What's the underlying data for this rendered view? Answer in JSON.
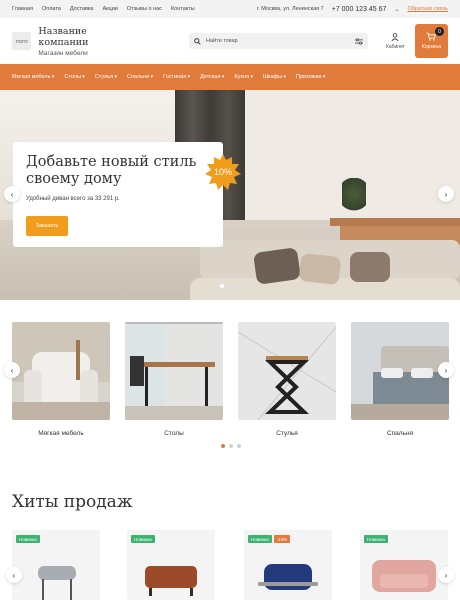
{
  "topbar": {
    "nav": [
      "Главная",
      "Оплата",
      "Доставка",
      "Акции",
      "Отзывы о нас",
      "Контакты"
    ],
    "address": "г. Москва, ул. Ленинская 7",
    "phone": "+7 000 123 45 67",
    "callback": "Обратная связь"
  },
  "header": {
    "logo": "ЛОГО",
    "company_name": "Название компании",
    "company_sub": "Магазин мебели",
    "search_placeholder": "Найти товар",
    "cabinet_label": "Кабинет",
    "cart_label": "Корзина",
    "cart_count": "0"
  },
  "catnav": {
    "items": [
      {
        "label": "Мягкая мебель",
        "arrow": true
      },
      {
        "label": "Столы",
        "arrow": true
      },
      {
        "label": "Стулья",
        "arrow": true
      },
      {
        "label": "Спальни",
        "arrow": true
      },
      {
        "label": "Гостиная",
        "arrow": true
      },
      {
        "label": "Детская",
        "arrow": true
      },
      {
        "label": "Кухня",
        "arrow": true
      },
      {
        "label": "Шкафы",
        "arrow": true
      },
      {
        "label": "Прихожая",
        "arrow": true
      }
    ]
  },
  "hero": {
    "title": "Добавьте новый стиль своему дому",
    "description": "Удобный диван всего за 33 291 р.",
    "button": "Заказать",
    "badge": "10%",
    "slides": 3,
    "active_slide": 0
  },
  "categories": {
    "items": [
      {
        "label": "Мягкая мебель"
      },
      {
        "label": "Столы"
      },
      {
        "label": "Стулья"
      },
      {
        "label": "Спальня"
      }
    ],
    "pages": 3,
    "active_page": 0
  },
  "hits": {
    "title": "Хиты продаж",
    "products": [
      {
        "tags": [
          "Новинка"
        ]
      },
      {
        "tags": [
          "Новинка"
        ]
      },
      {
        "tags": [
          "Новинка",
          "-10%"
        ]
      },
      {
        "tags": [
          "Новинка"
        ]
      }
    ]
  },
  "colors": {
    "accent": "#e07b3c",
    "button": "#f29c1c",
    "new_tag": "#3cb371"
  },
  "icons": [
    "search-icon",
    "filter-icon",
    "user-icon",
    "cart-icon",
    "chevron-left-icon",
    "chevron-right-icon",
    "chevron-down-icon"
  ]
}
